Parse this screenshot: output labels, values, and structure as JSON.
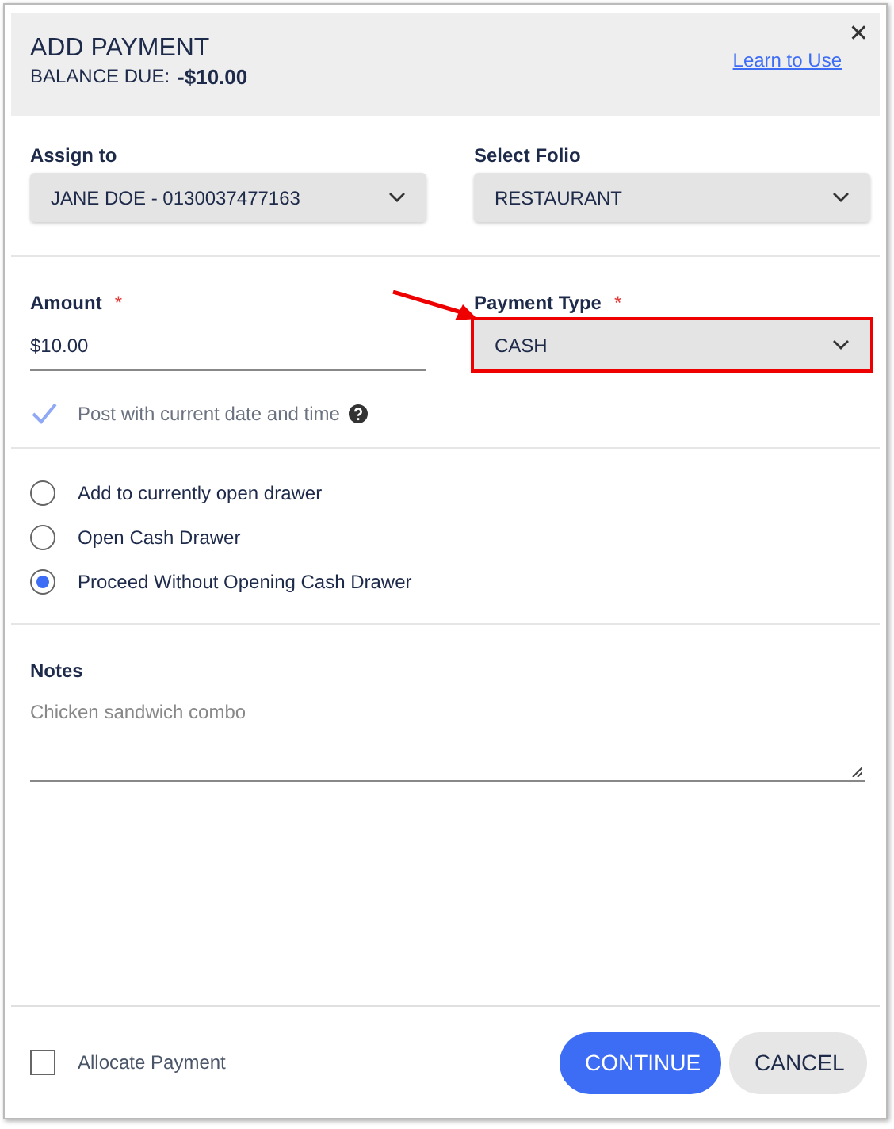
{
  "dialog": {
    "title": "ADD PAYMENT",
    "balance_label": "BALANCE DUE:",
    "balance_value": "-$10.00",
    "help_link": "Learn to Use",
    "close": "✕"
  },
  "selects": [
    {
      "label": "Assign to",
      "value": "JANE DOE - 0130037477163"
    },
    {
      "label": "Select Folio",
      "value": "RESTAURANT"
    }
  ],
  "amount": {
    "label": "Amount",
    "required_mark": "*",
    "value": "$10.00"
  },
  "payment_type": {
    "label": "Payment Type",
    "required_mark": "*",
    "value": "CASH",
    "highlighted": true
  },
  "post_now": {
    "label": "Post with current date and time",
    "checked": true
  },
  "drawer_options": [
    {
      "label": "Add to currently open drawer",
      "selected": false
    },
    {
      "label": "Open Cash Drawer",
      "selected": false
    },
    {
      "label": "Proceed Without Opening Cash Drawer",
      "selected": true
    }
  ],
  "notes": {
    "label": "Notes",
    "placeholder": "Chicken sandwich combo"
  },
  "allocate": {
    "label": "Allocate Payment",
    "checked": false
  },
  "buttons": [
    {
      "label": "CONTINUE",
      "kind": "primary"
    },
    {
      "label": "CANCEL",
      "kind": "secondary"
    }
  ]
}
